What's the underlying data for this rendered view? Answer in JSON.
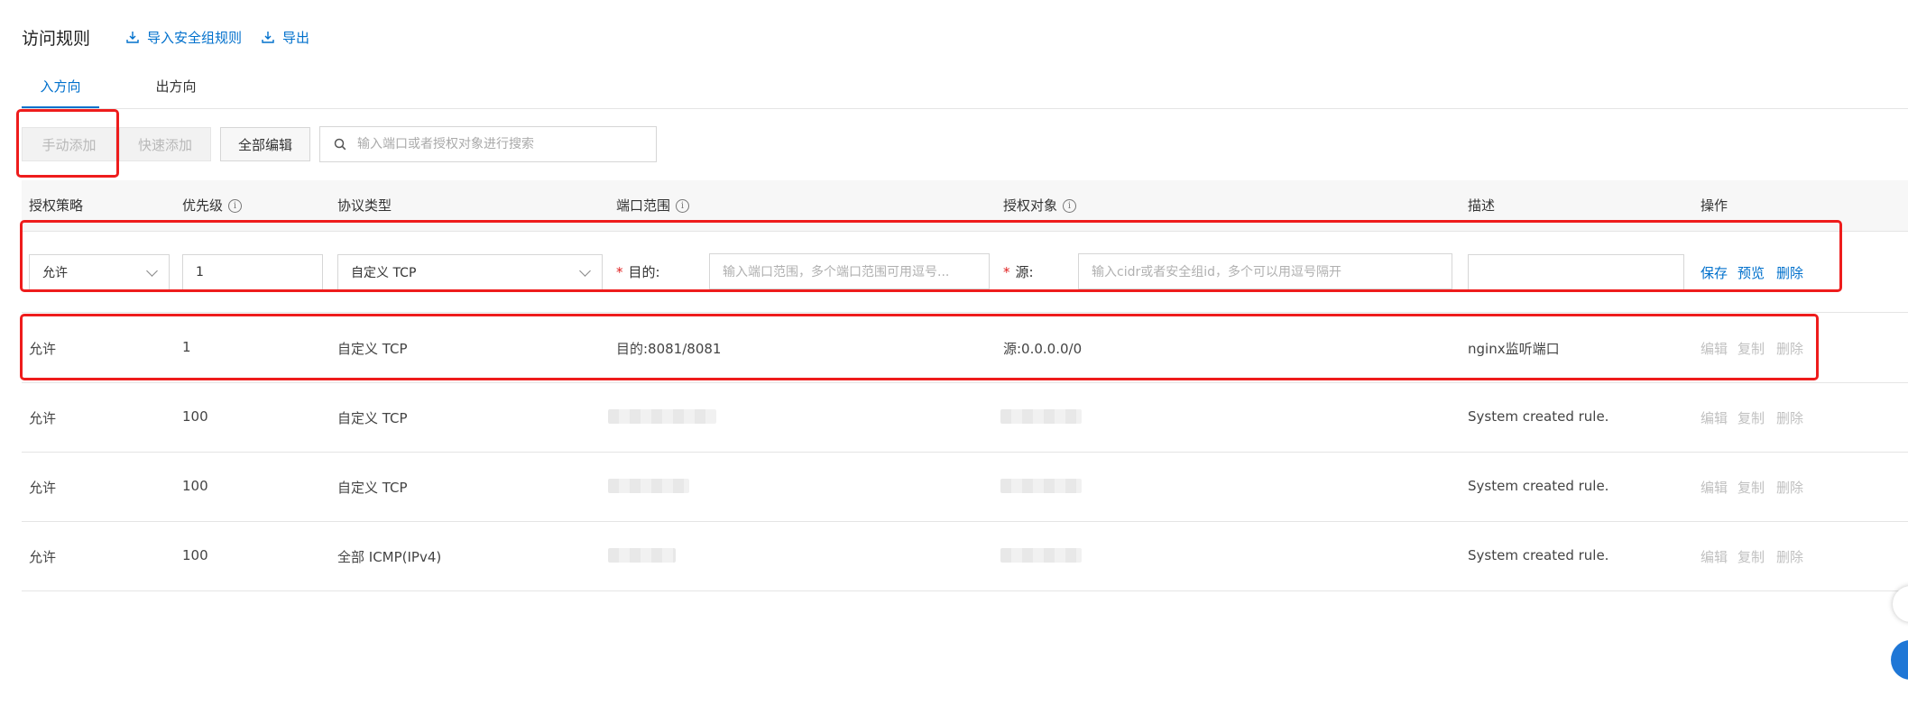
{
  "header": {
    "title": "访问规则",
    "import_label": "导入安全组规则",
    "export_label": "导出"
  },
  "tabs": [
    {
      "label": "入方向",
      "active": true
    },
    {
      "label": "出方向",
      "active": false
    }
  ],
  "toolbar": {
    "manual_add": "手动添加",
    "quick_add": "快速添加",
    "edit_all": "全部编辑",
    "search_placeholder": "输入端口或者授权对象进行搜索"
  },
  "columns": {
    "policy": "授权策略",
    "priority": "优先级",
    "protocol": "协议类型",
    "port_range": "端口范围",
    "auth_object": "授权对象",
    "description": "描述",
    "actions": "操作"
  },
  "edit_row": {
    "policy_value": "允许",
    "priority_value": "1",
    "protocol_value": "自定义 TCP",
    "dest_label": "目的:",
    "dest_placeholder": "输入端口范围，多个端口范围可用逗号...",
    "source_label": "源:",
    "source_placeholder": "输入cidr或者安全组id，多个可以用逗号隔开",
    "description_value": "",
    "actions": {
      "save": "保存",
      "preview": "预览",
      "delete": "删除"
    }
  },
  "rows": [
    {
      "policy": "允许",
      "priority": "1",
      "protocol": "自定义 TCP",
      "port": "目的:8081/8081",
      "object": "源:0.0.0.0/0",
      "description": "nginx监听端口"
    },
    {
      "policy": "允许",
      "priority": "100",
      "protocol": "自定义 TCP",
      "port": "",
      "object": "",
      "description": "System created rule."
    },
    {
      "policy": "允许",
      "priority": "100",
      "protocol": "自定义 TCP",
      "port": "",
      "object": "",
      "description": "System created rule."
    },
    {
      "policy": "允许",
      "priority": "100",
      "protocol": "全部 ICMP(IPv4)",
      "port": "",
      "object": "",
      "description": "System created rule."
    }
  ],
  "row_actions": {
    "edit": "编辑",
    "copy": "复制",
    "delete": "删除"
  },
  "colors": {
    "accent": "#0070cc",
    "annotation": "#ee1c1c",
    "disabled_text": "#c0c0c0"
  }
}
